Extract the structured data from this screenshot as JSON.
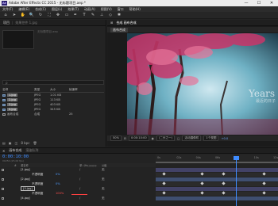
{
  "app": {
    "logo_text": "Ae",
    "title": "Adobe After Effects CC 2015 - 无标题项目.aep *",
    "window_controls": [
      "—",
      "☐",
      "✕"
    ]
  },
  "menu": [
    "文件(F)",
    "编辑(E)",
    "合成(C)",
    "图层(L)",
    "效果(T)",
    "动画(A)",
    "视图(V)",
    "窗口",
    "帮助(H)"
  ],
  "toolbar": {
    "tools": [
      {
        "name": "home-icon",
        "glyph": "⌂"
      },
      {
        "name": "select-tool-icon",
        "glyph": "➤"
      },
      {
        "name": "hand-tool-icon",
        "glyph": "✋"
      },
      {
        "name": "zoom-tool-icon",
        "glyph": "🔍"
      },
      {
        "name": "rotate-tool-icon",
        "glyph": "↻"
      },
      {
        "name": "camera-tool-icon",
        "glyph": "⛶"
      },
      {
        "name": "pan-behind-tool-icon",
        "glyph": "✥"
      },
      {
        "name": "rectangle-tool-icon",
        "glyph": "▭"
      },
      {
        "name": "pen-tool-icon",
        "glyph": "✒"
      },
      {
        "name": "text-tool-icon",
        "glyph": "T"
      },
      {
        "name": "brush-tool-icon",
        "glyph": "✎"
      },
      {
        "name": "stamp-tool-icon",
        "glyph": "⊥"
      },
      {
        "name": "eraser-tool-icon",
        "glyph": "◇"
      },
      {
        "name": "puppet-tool-icon",
        "glyph": "✱"
      }
    ]
  },
  "project": {
    "tab_label": "项目",
    "tab_secondary": "效果控件 1.jpg",
    "file_caption": "无标题项目.aep",
    "search_placeholder": "ρ",
    "columns": {
      "name": "名称",
      "type": "类型",
      "size": "大小",
      "rate": "帧速率"
    },
    "rows": [
      {
        "name": "1.jpg",
        "type": "JPEG",
        "size": "1.01 KB",
        "rate": "",
        "selected": true
      },
      {
        "name": "2.jpg",
        "type": "JPEG",
        "size": "113 KB",
        "rate": "",
        "selected": true
      },
      {
        "name": "3.jpg",
        "type": "JPEG",
        "size": "403 KB",
        "rate": "",
        "selected": true
      },
      {
        "name": "4.jpg",
        "type": "JPEG",
        "size": "345 KB",
        "rate": "",
        "selected": true
      },
      {
        "name": "画布合成",
        "type": "合成",
        "size": "",
        "rate": "25",
        "selected": false
      }
    ],
    "footer_bpc": "8 bpc"
  },
  "composition": {
    "tab_label": "合成 画布合成",
    "breadcrumb": "画布合成",
    "watermark_en": "Years",
    "watermark_cn": "最近的日子",
    "zoom": "50%",
    "timecode": "0:00:10:00",
    "resolution": "(二分之一)",
    "camera": "活动摄像机",
    "views": "1个视图",
    "overlay": "+0.0"
  },
  "timeline": {
    "tab_label": "画布合成",
    "render_queue": "渲染队列",
    "current_time": "0:00:10:00",
    "time_sub": "00250 (25.00 fps)",
    "ruler_ticks": [
      "0s",
      "02s",
      "04s",
      "06s",
      "08s",
      "10s",
      "12s"
    ],
    "columns": {
      "num": "#",
      "source": "源名称",
      "switches": "单☆\\fx□◎◎◎",
      "parent": "父级"
    },
    "layers": [
      {
        "kind": "layer",
        "name": "[1.jpg]",
        "number": "1",
        "parent": "无"
      },
      {
        "kind": "sub",
        "name": "不透明度",
        "value": "0%"
      },
      {
        "kind": "layer",
        "name": "[2.jpg]",
        "number": "2",
        "parent": "无"
      },
      {
        "kind": "sub",
        "name": "不透明度",
        "value": "0%"
      },
      {
        "kind": "layer",
        "name": "[3.jpg]",
        "number": "3",
        "parent": "无",
        "boxed": true
      },
      {
        "kind": "sub",
        "name": "不透明度",
        "value": "100%",
        "red": true
      },
      {
        "kind": "layer",
        "name": "[4.jpg]",
        "number": "4",
        "parent": "无"
      }
    ]
  },
  "colors": {
    "accent": "#3f8cff",
    "warning": "#ff4040"
  }
}
